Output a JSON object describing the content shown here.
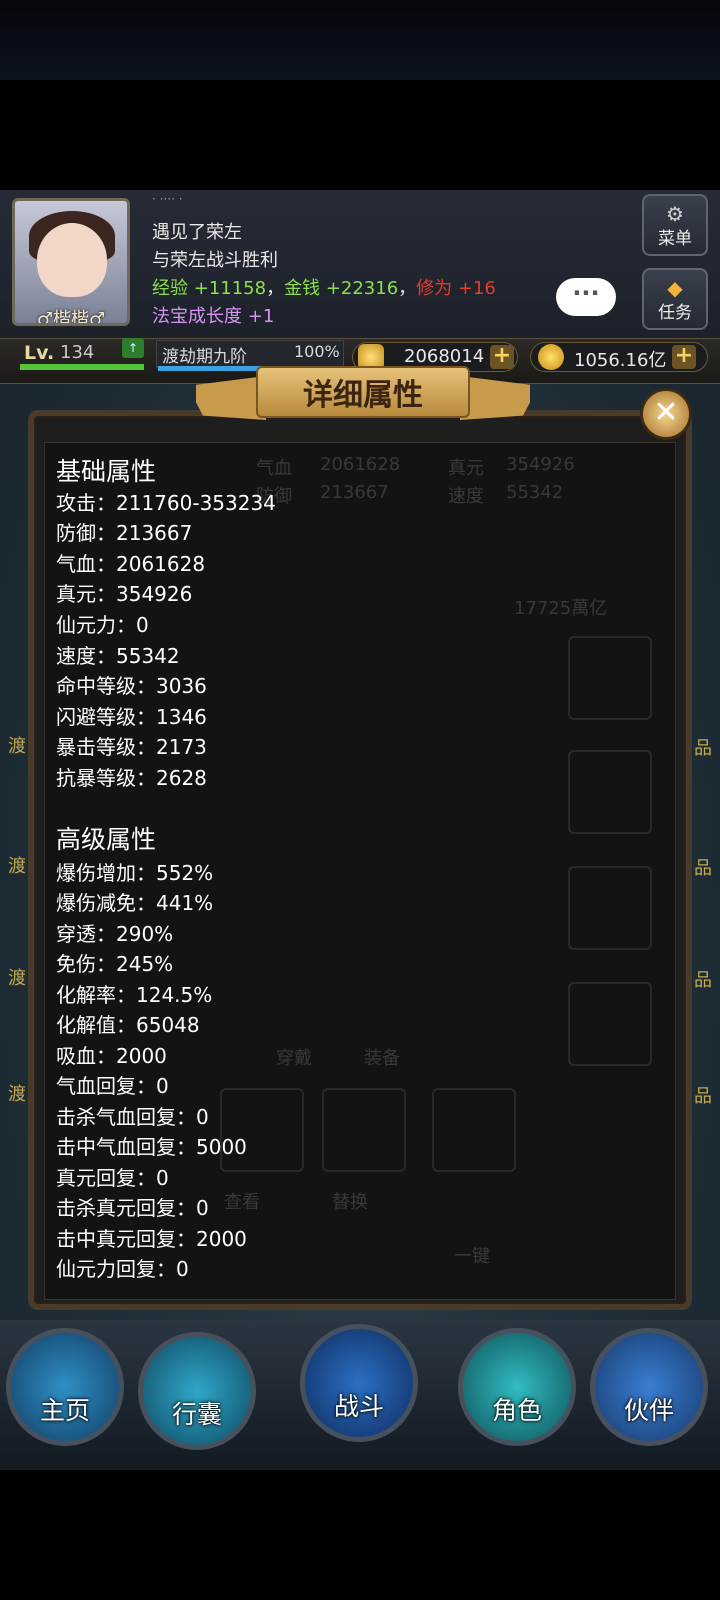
{
  "header": {
    "player_name": "♂楷楷♂",
    "log_top_partial": "· ···· ·",
    "log_line1": "遇见了荣左",
    "log_line2": "与荣左战斗胜利",
    "reward": {
      "exp_label": "经验",
      "exp_value": "+11158",
      "sep1": "，",
      "money_label": "金钱",
      "money_value": "+22316",
      "sep2": "，",
      "cult_label": "修为",
      "cult_value": "+16"
    },
    "treasure_label": "法宝成长度",
    "treasure_value": "+1",
    "menu_label": "菜单",
    "task_label": "任务",
    "chat_icon": "···"
  },
  "status": {
    "lv_label": "Lv.",
    "lv_value": "134",
    "realm_label": "渡劫期九阶",
    "realm_percent": "100%",
    "realm_progress": 1.0,
    "ingot_value": "2068014",
    "gold_value": "1056.16亿"
  },
  "modal": {
    "title": "详细属性",
    "close_icon": "✕",
    "basic_title": "基础属性",
    "basic": [
      "攻击：211760-353234",
      "防御：213667",
      "气血：2061628",
      "真元：354926",
      "仙元力：0",
      "速度：55342",
      "命中等级：3036",
      "闪避等级：1346",
      "暴击等级：2173",
      "抗暴等级：2628"
    ],
    "advanced_title": "高级属性",
    "advanced": [
      "爆伤增加：552%",
      "爆伤减免：441%",
      "穿透：290%",
      "免伤：245%",
      "化解率：124.5%",
      "化解值：65048",
      "吸血：2000",
      "气血回复：0",
      "击杀气血回复：0",
      "击中气血回复：5000",
      "真元回复：0",
      "击杀真元回复：0",
      "击中真元回复：2000",
      "仙元力回复：0"
    ]
  },
  "background": {
    "edge_left": "渡",
    "edge_right": "品",
    "ghost": [
      "气血",
      "2061628",
      "真元",
      "354926",
      "防御",
      "213667",
      "速度",
      "55342",
      "17725萬亿",
      "穿戴",
      "装备",
      "查看",
      "替换",
      "一键"
    ]
  },
  "nav": [
    "主页",
    "行囊",
    "战斗",
    "角色",
    "伙伴"
  ],
  "colors": {
    "exp": "#8be04b",
    "cultivation": "#e53b2a",
    "treasure": "#d894f2",
    "nav_home": "#1f6aa0",
    "nav_bag": "#1c7fa6",
    "nav_battle": "#1a4fa0",
    "nav_role": "#1f9aa4",
    "nav_partner": "#2b5ea8"
  }
}
